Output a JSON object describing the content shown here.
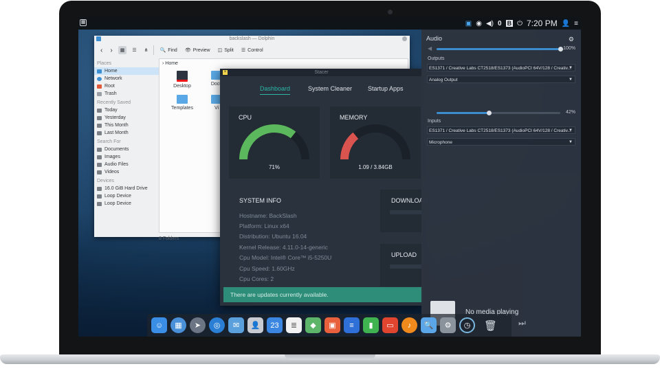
{
  "top_panel": {
    "tray_badge": "0",
    "clock": "7:20 PM"
  },
  "dolphin": {
    "window_title": "backslash — Dolphin",
    "toolbar": {
      "find": "Find",
      "preview": "Preview",
      "split": "Split",
      "control": "Control"
    },
    "breadcrumb": "Home",
    "places": {
      "sections": [
        {
          "title": "Places",
          "items": [
            "Home",
            "Network",
            "Root",
            "Trash"
          ]
        },
        {
          "title": "Recently Saved",
          "items": [
            "Today",
            "Yesterday",
            "This Month",
            "Last Month"
          ]
        },
        {
          "title": "Search For",
          "items": [
            "Documents",
            "Images",
            "Audio Files",
            "Videos"
          ]
        },
        {
          "title": "Devices",
          "items": [
            "16.0 GiB Hard Drive",
            "Loop Device",
            "Loop Device"
          ]
        }
      ]
    },
    "files": [
      "Desktop",
      "Docu",
      "Templates",
      "Vi"
    ],
    "status": "8 Folders"
  },
  "stacer": {
    "window_title": "Stacer",
    "tabs": [
      "Dashboard",
      "System Cleaner",
      "Startup Apps"
    ],
    "active_tab": "Dashboard",
    "cpu": {
      "title": "CPU",
      "value_label": "71%",
      "fraction": 0.71
    },
    "memory": {
      "title": "MEMORY",
      "value_label": "1.09 / 3.84GB",
      "fraction": 0.28
    },
    "system_info": {
      "title": "SYSTEM INFO",
      "lines": [
        "Hostname: BackSlash",
        "Platform: Linux x64",
        "Distribution: Ubuntu 16.04",
        "Kernel Release: 4.11.0-14-generic",
        "Cpu Model: Intel® Core™ i5-5250U",
        "Cpu Speed: 1.60GHz",
        "Cpu Cores: 2"
      ]
    },
    "download": "DOWNLOAD",
    "upload": "UPLOAD",
    "update_notice": "There are updates currently available."
  },
  "audio": {
    "title": "Audio",
    "master_volume_label": "100%",
    "master_volume": 1.0,
    "outputs_label": "Outputs",
    "output_device": "ES1371 / Creative Labs CT2518/ES1373 (AudioPCI 64V/128 / Creativ...",
    "output_port": "Analog Output",
    "output_volume_label": "42%",
    "output_volume": 0.42,
    "inputs_label": "Inputs",
    "input_device": "ES1371 / Creative Labs CT2518/ES1373 (AudioPCI 64V/128 / Creativ...",
    "input_port": "Microphone",
    "media_status": "No media playing"
  },
  "dock": {
    "calendar_day": "23",
    "apps": [
      "finder-icon",
      "launchpad-icon",
      "rocket-icon",
      "browser-icon",
      "mail-icon",
      "contacts-icon",
      "calendar-icon",
      "notes-icon",
      "maps-icon",
      "photos-icon",
      "documents-icon",
      "spreadsheet-icon",
      "presentation-icon",
      "music-icon",
      "preview-icon",
      "settings-icon",
      "stacer-icon",
      "trash-icon"
    ]
  }
}
